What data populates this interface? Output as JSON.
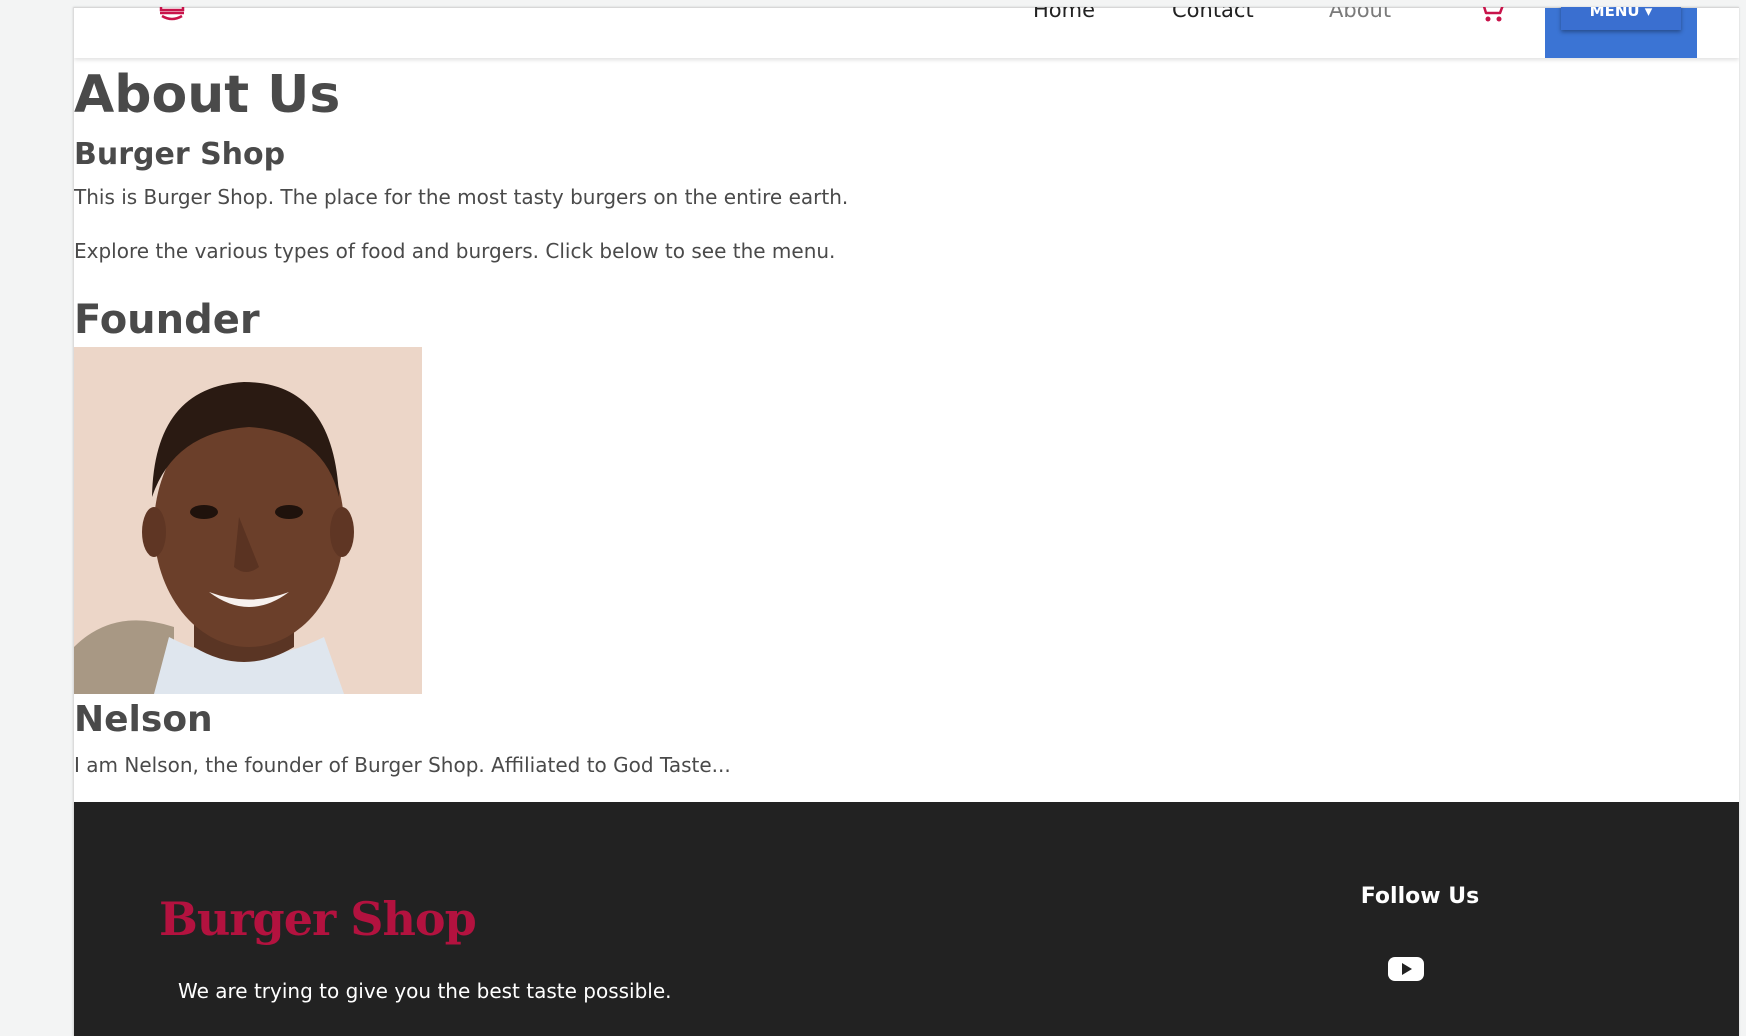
{
  "nav": {
    "links": [
      {
        "label": "Home"
      },
      {
        "label": "Contact"
      },
      {
        "label": "About"
      }
    ],
    "menu_button": "MENU ▾",
    "brand_icon": "burger-icon",
    "cart_icon": "cart-icon",
    "accent_color": "#3b74d4",
    "brand_color": "#b3123f"
  },
  "about": {
    "title": "About Us",
    "subtitle": "Burger Shop",
    "paragraph1": "This is Burger Shop. The place for the most tasty burgers on the entire earth.",
    "paragraph2": "Explore the various types of food and burgers. Click below to see the menu."
  },
  "founder": {
    "heading": "Founder",
    "name": "Nelson",
    "bio": "I am Nelson, the founder of Burger Shop. Affiliated to God Taste..."
  },
  "footer": {
    "brand": "Burger Shop",
    "tagline": "We are trying to give you the best taste possible.",
    "follow_title": "Follow Us",
    "social_icon": "youtube-icon",
    "background": "#222222"
  }
}
